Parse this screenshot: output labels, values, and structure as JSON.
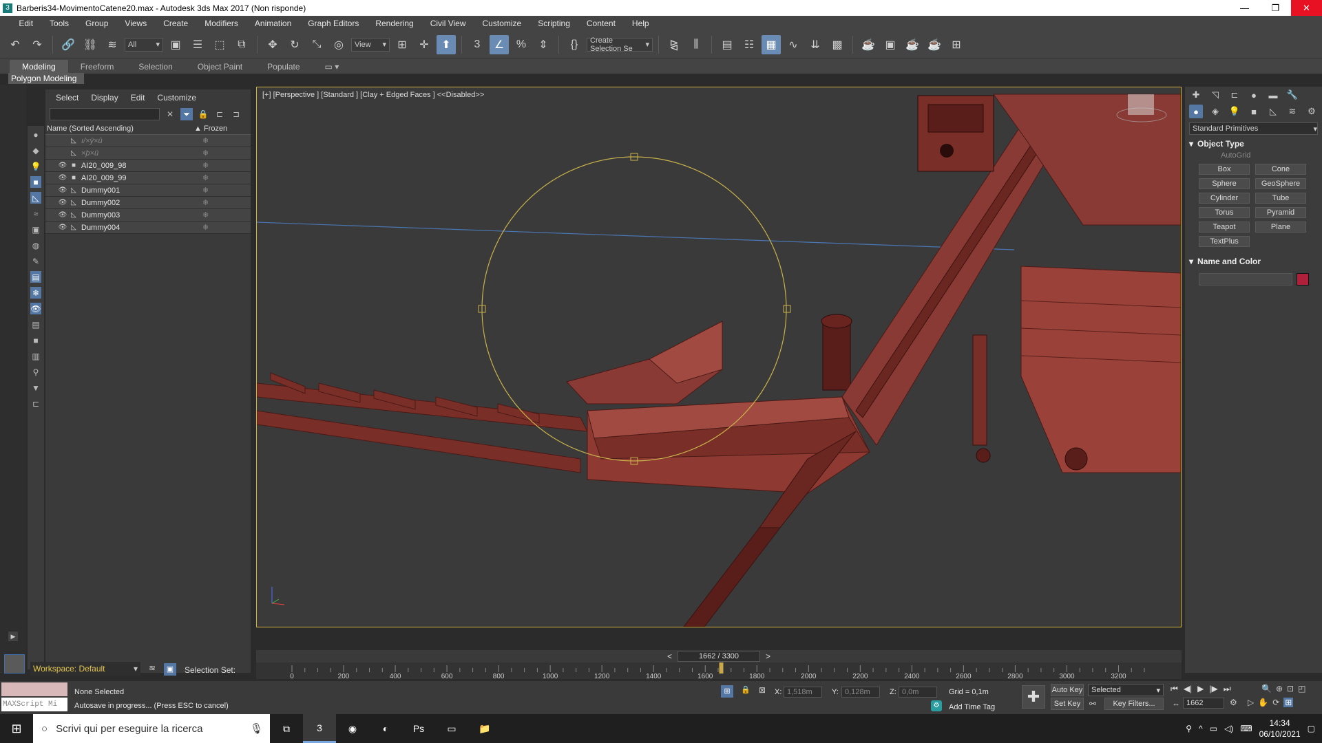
{
  "window": {
    "title": "Barberis34-MovimentoCatene20.max - Autodesk 3ds Max 2017  (Non risponde)",
    "app_icon": "3"
  },
  "menu": [
    "Edit",
    "Tools",
    "Group",
    "Views",
    "Create",
    "Modifiers",
    "Animation",
    "Graph Editors",
    "Rendering",
    "Civil View",
    "Customize",
    "Scripting",
    "Content",
    "Help"
  ],
  "toolbar": {
    "filter": "All",
    "refcoord": "View",
    "selection_set": "Create Selection Se"
  },
  "ribbon": {
    "tabs": [
      "Modeling",
      "Freeform",
      "Selection",
      "Object Paint",
      "Populate"
    ],
    "active": "Modeling",
    "sub": "Polygon Modeling"
  },
  "scene_explorer": {
    "menu": [
      "Select",
      "Display",
      "Edit",
      "Customize"
    ],
    "columns": {
      "name": "Name (Sorted Ascending)",
      "frozen": "▲ Frozen"
    },
    "rows": [
      {
        "name": "ı/×ÿ×û",
        "dim": true
      },
      {
        "name": "×þ×ü",
        "dim": true
      },
      {
        "name": "AI20_009_98",
        "dim": false
      },
      {
        "name": "AI20_009_99",
        "dim": false
      },
      {
        "name": "Dummy001",
        "dim": false
      },
      {
        "name": "Dummy002",
        "dim": false
      },
      {
        "name": "Dummy003",
        "dim": false
      },
      {
        "name": "Dummy004",
        "dim": false
      }
    ]
  },
  "viewport": {
    "label": "[+] [Perspective ] [Standard ] [Clay + Edged Faces ]  <<Disabled>>"
  },
  "command_panel": {
    "category": "Standard Primitives",
    "object_type_title": "Object Type",
    "autogrid": "AutoGrid",
    "buttons": [
      "Box",
      "Cone",
      "Sphere",
      "GeoSphere",
      "Cylinder",
      "Tube",
      "Torus",
      "Pyramid",
      "Teapot",
      "Plane",
      "TextPlus"
    ],
    "name_color_title": "Name and Color",
    "swatch_color": "#b0203a"
  },
  "time": {
    "slider": "1662 / 3300",
    "ticks": [
      "0",
      "200",
      "400",
      "600",
      "800",
      "1000",
      "1200",
      "1400",
      "1600",
      "1800",
      "2000",
      "2200",
      "2400",
      "2600",
      "2800",
      "3000",
      "3200"
    ],
    "current_frame": "1662",
    "total_frames": 3300
  },
  "workspace": {
    "label": "Workspace: Default",
    "selection_set": "Selection Set:"
  },
  "status": {
    "selected": "None Selected",
    "prompt": "Autosave in progress... (Press ESC to cancel)",
    "maxscript": "MAXScript Mi",
    "x_label": "X:",
    "x": "1,518m",
    "y_label": "Y:",
    "y": "0,128m",
    "z_label": "Z:",
    "z": "0,0m",
    "grid": "Grid = 0,1m",
    "add_time_tag": "Add Time Tag",
    "auto_key": "Auto Key",
    "set_key": "Set Key",
    "key_mode": "Selected",
    "key_filters": "Key Filters...",
    "frame": "1662"
  },
  "taskbar": {
    "search": "Scrivi qui per eseguire la ricerca",
    "time": "14:34",
    "date": "06/10/2021"
  },
  "colors": {
    "viewport_border": "#d4b13a",
    "model": "#8a3a34",
    "gizmo": "#c9b24a",
    "accent": "#5477a3"
  }
}
